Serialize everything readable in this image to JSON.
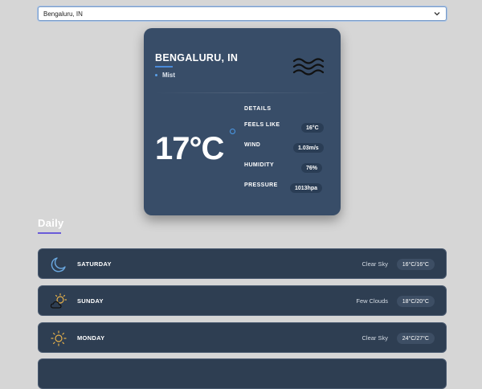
{
  "search": {
    "value": "Bengaluru, IN"
  },
  "current": {
    "city": "BENGALURU, IN",
    "condition": "Mist",
    "temperature": "17°C",
    "icon": "mist-icon",
    "details_title": "DETAILS",
    "details": [
      {
        "label": "FEELS LIKE",
        "value": "16°C"
      },
      {
        "label": "WIND",
        "value": "1.03m/s"
      },
      {
        "label": "HUMIDITY",
        "value": "76%"
      },
      {
        "label": "PRESSURE",
        "value": "1013hpa"
      }
    ]
  },
  "daily": {
    "title": "Daily",
    "days": [
      {
        "name": "SATURDAY",
        "description": "Clear Sky",
        "range": "16°C/16°C",
        "icon": "moon-icon"
      },
      {
        "name": "SUNDAY",
        "description": "Few Clouds",
        "range": "18°C/20°C",
        "icon": "partly-cloudy-icon"
      },
      {
        "name": "MONDAY",
        "description": "Clear Sky",
        "range": "24°C/27°C",
        "icon": "sun-icon"
      }
    ]
  },
  "colors": {
    "background": "#d6d6d6",
    "card": "#384d68",
    "row": "#2e3e52",
    "accent_blue": "#4a8ad8",
    "accent_purple": "#6a5cd8",
    "sun": "#e8b24a"
  }
}
